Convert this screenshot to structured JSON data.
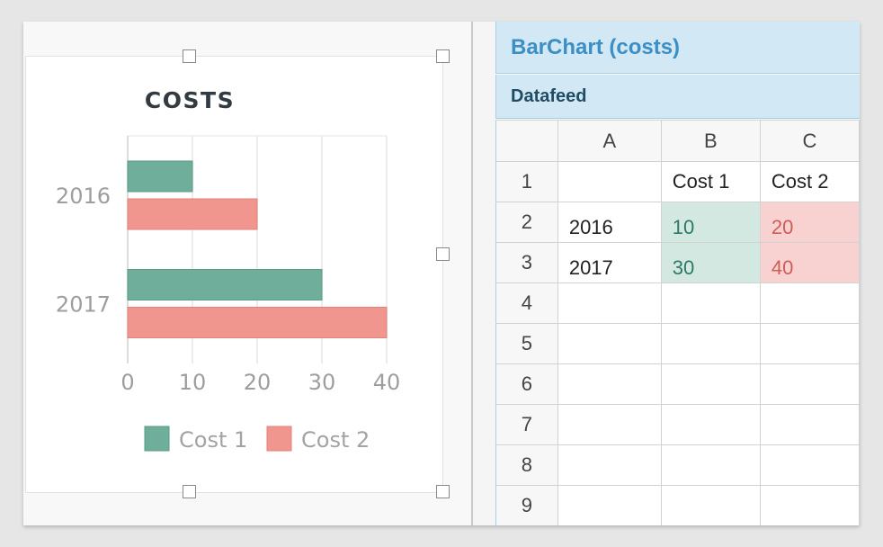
{
  "chart_data": {
    "type": "bar",
    "orientation": "horizontal",
    "title": "COSTS",
    "categories": [
      "2016",
      "2017"
    ],
    "series": [
      {
        "name": "Cost 1",
        "values": [
          10,
          30
        ],
        "color": "#6fae9a"
      },
      {
        "name": "Cost 2",
        "values": [
          20,
          40
        ],
        "color": "#f1958f"
      }
    ],
    "xlim": [
      0,
      40
    ],
    "x_ticks": [
      "0",
      "10",
      "20",
      "30",
      "40"
    ],
    "grid": true,
    "legend": "bottom"
  },
  "panel": {
    "title": "BarChart (costs)",
    "subtitle": "Datafeed"
  },
  "sheet": {
    "columns": [
      "A",
      "B",
      "C"
    ],
    "row_numbers": [
      "1",
      "2",
      "3",
      "4",
      "5",
      "6",
      "7",
      "8",
      "9"
    ],
    "header_row": [
      "",
      "Cost 1",
      "Cost 2"
    ],
    "rows": [
      [
        "2016",
        "10",
        "20"
      ],
      [
        "2017",
        "30",
        "40"
      ]
    ]
  },
  "colors": {
    "cost1": "#6fae9a",
    "cost2": "#f1958f",
    "panel_header_bg": "#d2e8f4",
    "panel_title": "#3b8fc4"
  }
}
